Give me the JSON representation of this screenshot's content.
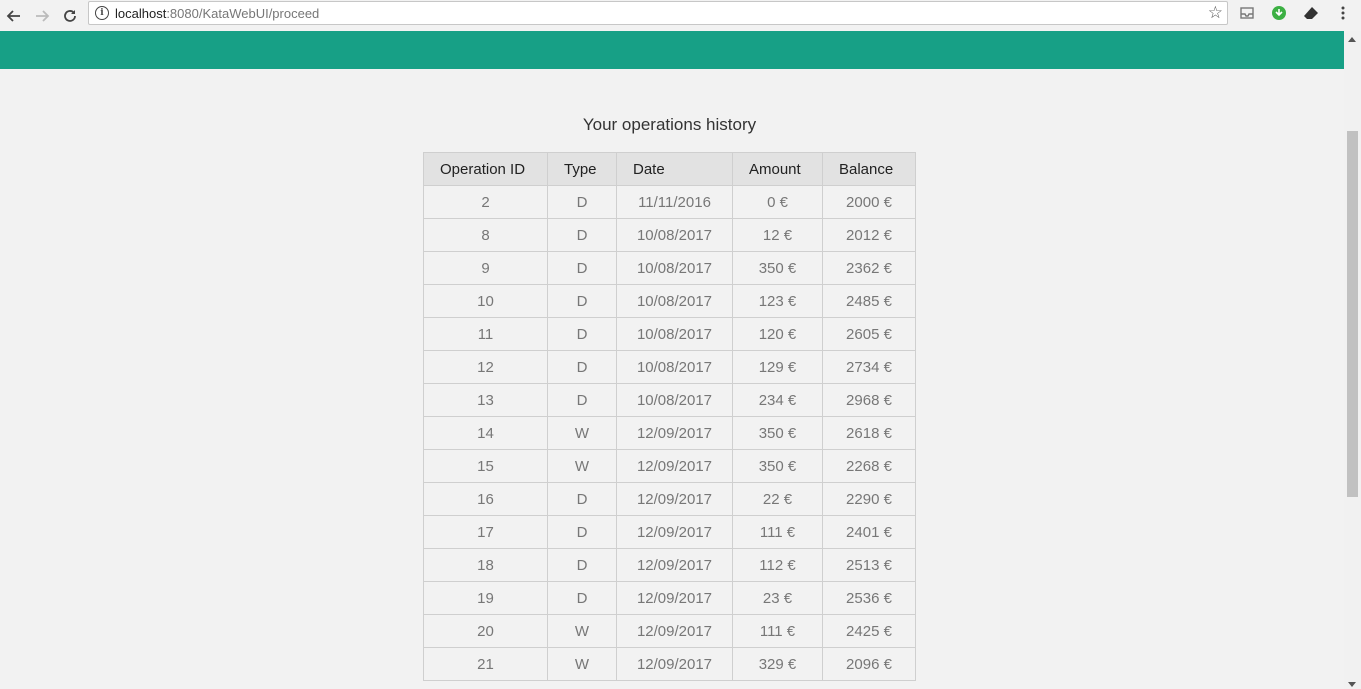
{
  "browser": {
    "url_host": "localhost",
    "url_rest": ":8080/KataWebUI/proceed"
  },
  "page": {
    "title": "Your operations history"
  },
  "table": {
    "headers": [
      "Operation ID",
      "Type",
      "Date",
      "Amount",
      "Balance"
    ],
    "rows": [
      [
        "2",
        "D",
        "11/11/2016",
        "0 €",
        "2000 €"
      ],
      [
        "8",
        "D",
        "10/08/2017",
        "12 €",
        "2012 €"
      ],
      [
        "9",
        "D",
        "10/08/2017",
        "350 €",
        "2362 €"
      ],
      [
        "10",
        "D",
        "10/08/2017",
        "123 €",
        "2485 €"
      ],
      [
        "11",
        "D",
        "10/08/2017",
        "120 €",
        "2605 €"
      ],
      [
        "12",
        "D",
        "10/08/2017",
        "129 €",
        "2734 €"
      ],
      [
        "13",
        "D",
        "10/08/2017",
        "234 €",
        "2968 €"
      ],
      [
        "14",
        "W",
        "12/09/2017",
        "350 €",
        "2618 €"
      ],
      [
        "15",
        "W",
        "12/09/2017",
        "350 €",
        "2268 €"
      ],
      [
        "16",
        "D",
        "12/09/2017",
        "22 €",
        "2290 €"
      ],
      [
        "17",
        "D",
        "12/09/2017",
        "111 €",
        "2401 €"
      ],
      [
        "18",
        "D",
        "12/09/2017",
        "112 €",
        "2513 €"
      ],
      [
        "19",
        "D",
        "12/09/2017",
        "23 €",
        "2536 €"
      ],
      [
        "20",
        "W",
        "12/09/2017",
        "111 €",
        "2425 €"
      ],
      [
        "21",
        "W",
        "12/09/2017",
        "329 €",
        "2096 €"
      ]
    ]
  },
  "colors": {
    "header_band": "#17a086",
    "page_background": "#f2f2f2"
  }
}
